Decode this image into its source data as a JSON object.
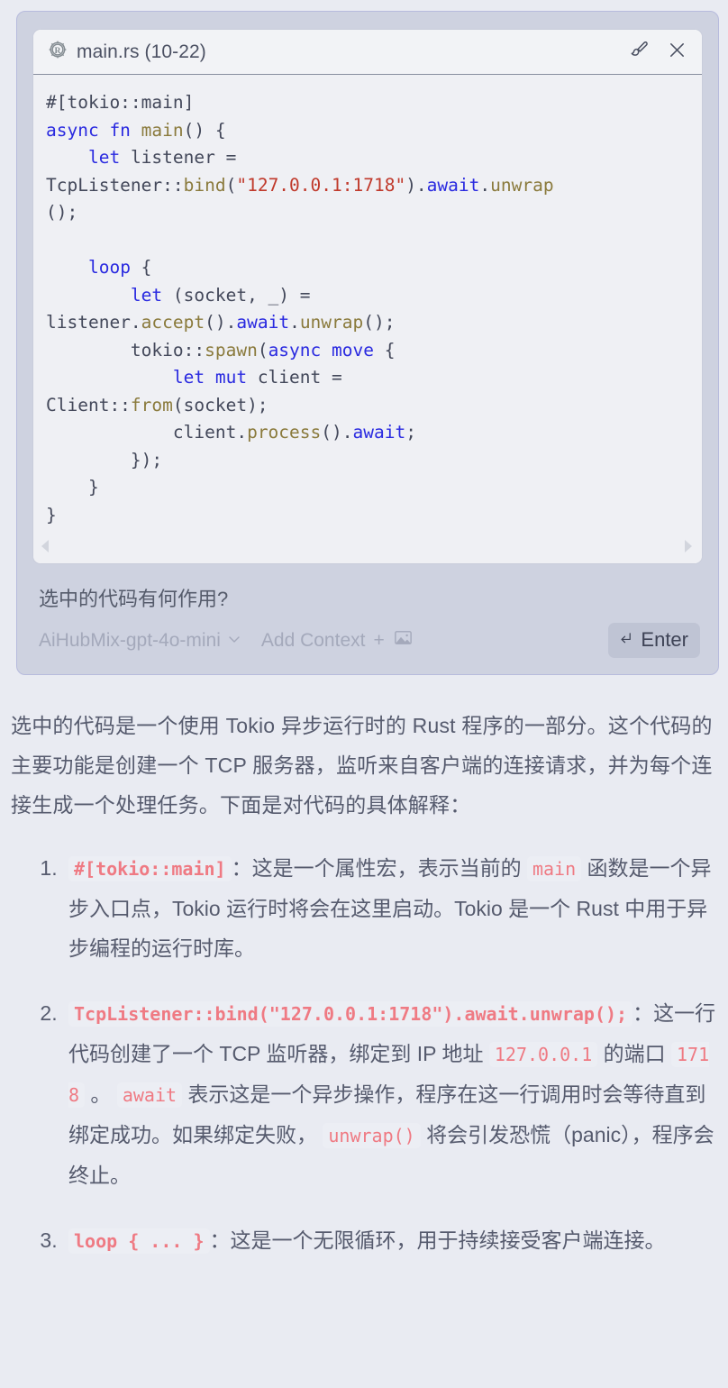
{
  "colors": {
    "page_bg": "#e9ebf2",
    "composer_bg": "#ced2e0",
    "composer_border": "#b7bbdd",
    "code_card_bg": "#eff0f4",
    "code_header_bg": "#f2f3f6",
    "inline_code_text": "#ef7a83",
    "inline_code_bg": "#eceef4",
    "keyword_blue": "#2a2ae0",
    "function_gold": "#8a7a3c",
    "string_red": "#c0392b",
    "enter_button_bg": "#bfc4d4",
    "muted_text": "#a4a9bb",
    "body_text": "#565b6e"
  },
  "code_card": {
    "icon": "rust-icon",
    "title": "main.rs (10-22)",
    "actions": [
      {
        "icon": "paintbrush-icon",
        "name": "edit-with-brush-button"
      },
      {
        "icon": "close-icon",
        "name": "close-code-card-button"
      }
    ],
    "language": "rust",
    "scroll": {
      "left_arrow": "chevron-left-icon",
      "right_arrow": "chevron-right-icon"
    },
    "lines": [
      {
        "tokens": [
          {
            "t": "#[tokio::main]",
            "c": "att"
          }
        ]
      },
      {
        "tokens": [
          {
            "t": "async fn ",
            "c": "kw"
          },
          {
            "t": "main",
            "c": "fnn"
          },
          {
            "t": "() {",
            "c": "pun"
          }
        ]
      },
      {
        "tokens": [
          {
            "t": "    ",
            "c": "pun"
          },
          {
            "t": "let",
            "c": "kw"
          },
          {
            "t": " listener =",
            "c": "pun"
          }
        ]
      },
      {
        "tokens": [
          {
            "t": "TcpListener::",
            "c": "pun"
          },
          {
            "t": "bind",
            "c": "fnn"
          },
          {
            "t": "(",
            "c": "pun"
          },
          {
            "t": "\"127.0.0.1:1718\"",
            "c": "str"
          },
          {
            "t": ").",
            "c": "pun"
          },
          {
            "t": "await",
            "c": "kw"
          },
          {
            "t": ".",
            "c": "pun"
          },
          {
            "t": "unwrap",
            "c": "fnn"
          }
        ]
      },
      {
        "tokens": [
          {
            "t": "();",
            "c": "pun"
          }
        ]
      },
      {
        "tokens": [
          {
            "t": "",
            "c": "pun"
          }
        ]
      },
      {
        "tokens": [
          {
            "t": "    ",
            "c": "pun"
          },
          {
            "t": "loop",
            "c": "kw"
          },
          {
            "t": " {",
            "c": "pun"
          }
        ]
      },
      {
        "tokens": [
          {
            "t": "        ",
            "c": "pun"
          },
          {
            "t": "let",
            "c": "kw"
          },
          {
            "t": " (socket, _) =",
            "c": "pun"
          }
        ]
      },
      {
        "tokens": [
          {
            "t": "listener.",
            "c": "pun"
          },
          {
            "t": "accept",
            "c": "fnn"
          },
          {
            "t": "().",
            "c": "pun"
          },
          {
            "t": "await",
            "c": "kw"
          },
          {
            "t": ".",
            "c": "pun"
          },
          {
            "t": "unwrap",
            "c": "fnn"
          },
          {
            "t": "();",
            "c": "pun"
          }
        ]
      },
      {
        "tokens": [
          {
            "t": "        tokio::",
            "c": "pun"
          },
          {
            "t": "spawn",
            "c": "fnn"
          },
          {
            "t": "(",
            "c": "pun"
          },
          {
            "t": "async move",
            "c": "kw"
          },
          {
            "t": " {",
            "c": "pun"
          }
        ]
      },
      {
        "tokens": [
          {
            "t": "            ",
            "c": "pun"
          },
          {
            "t": "let mut",
            "c": "kw"
          },
          {
            "t": " client =",
            "c": "pun"
          }
        ]
      },
      {
        "tokens": [
          {
            "t": "Client::",
            "c": "pun"
          },
          {
            "t": "from",
            "c": "fnn"
          },
          {
            "t": "(socket);",
            "c": "pun"
          }
        ]
      },
      {
        "tokens": [
          {
            "t": "            client.",
            "c": "pun"
          },
          {
            "t": "process",
            "c": "fnn"
          },
          {
            "t": "().",
            "c": "pun"
          },
          {
            "t": "await",
            "c": "kw"
          },
          {
            "t": ";",
            "c": "pun"
          }
        ]
      },
      {
        "tokens": [
          {
            "t": "        });",
            "c": "pun"
          }
        ]
      },
      {
        "tokens": [
          {
            "t": "    }",
            "c": "pun"
          }
        ]
      },
      {
        "tokens": [
          {
            "t": "}",
            "c": "pun"
          }
        ]
      }
    ]
  },
  "composer": {
    "prompt_value": "选中的代码有何作用?",
    "model_label": "AiHubMix-gpt-4o-mini",
    "model_chevron": "chevron-down-icon",
    "add_context_label": "Add Context",
    "add_context_plus": "+",
    "add_context_image_icon": "image-icon",
    "enter_label": "Enter",
    "enter_icon": "return-key-icon"
  },
  "answer": {
    "intro": "选中的代码是一个使用 Tokio 异步运行时的 Rust 程序的一部分。这个代码的主要功能是创建一个 TCP 服务器，监听来自客户端的连接请求，并为每个连接生成一个处理任务。下面是对代码的具体解释：",
    "items": [
      {
        "parts": [
          {
            "type": "code",
            "text": "#[tokio::main]",
            "bold": true
          },
          {
            "type": "text",
            "text": "：这是一个属性宏，表示当前的 "
          },
          {
            "type": "code",
            "text": "main",
            "bold": false
          },
          {
            "type": "text",
            "text": " 函数是一个异步入口点，Tokio 运行时将会在这里启动。Tokio 是一个 Rust 中用于异步编程的运行时库。"
          }
        ]
      },
      {
        "parts": [
          {
            "type": "code",
            "text": "TcpListener::bind(\"127.0.0.1:1718\").await.unwrap();",
            "bold": true
          },
          {
            "type": "text",
            "text": "：这一行代码创建了一个 TCP 监听器，绑定到 IP 地址 "
          },
          {
            "type": "code",
            "text": "127.0.0.1",
            "bold": false
          },
          {
            "type": "text",
            "text": " 的端口 "
          },
          {
            "type": "code",
            "text": "1718",
            "bold": false
          },
          {
            "type": "text",
            "text": " 。 "
          },
          {
            "type": "code",
            "text": "await",
            "bold": false
          },
          {
            "type": "text",
            "text": " 表示这是一个异步操作，程序在这一行调用时会等待直到绑定成功。如果绑定失败， "
          },
          {
            "type": "code",
            "text": "unwrap()",
            "bold": false
          },
          {
            "type": "text",
            "text": " 将会引发恐慌（panic），程序会终止。"
          }
        ]
      },
      {
        "parts": [
          {
            "type": "code",
            "text": "loop { ... }",
            "bold": true
          },
          {
            "type": "text",
            "text": "：这是一个无限循环，用于持续接受客户端连接。"
          }
        ]
      }
    ]
  }
}
